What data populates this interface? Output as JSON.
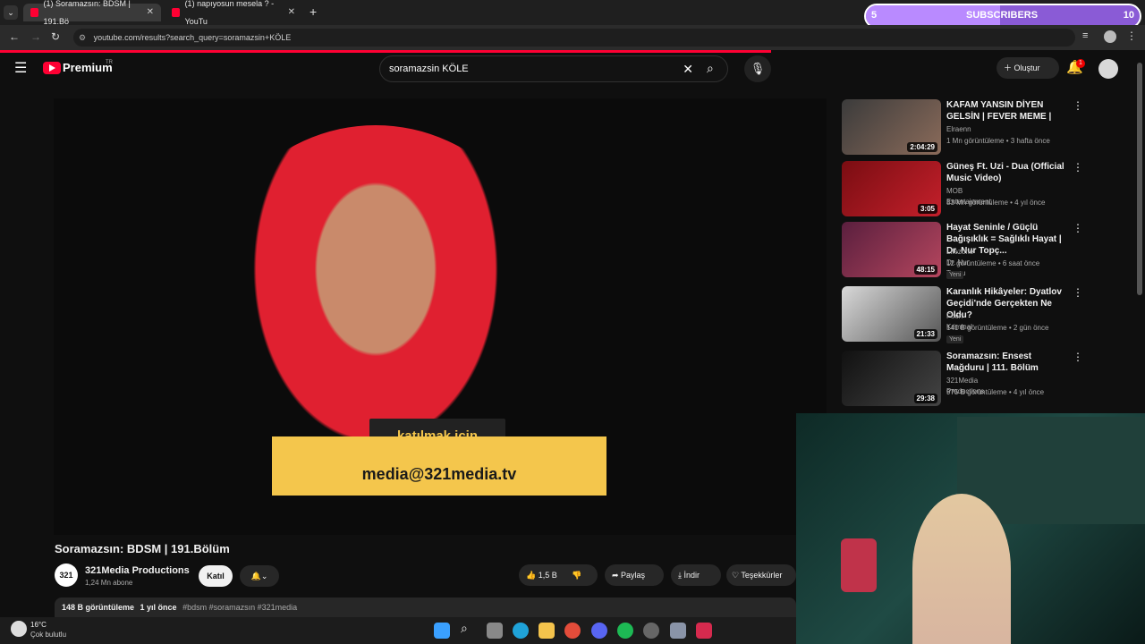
{
  "browser": {
    "tabs": [
      {
        "title": "(1) Soramazsın: BDSM | 191.Bö"
      },
      {
        "title": "(1) napıyosun mesela ? - YouTu"
      }
    ],
    "url": "youtube.com/results?search_query=soramazsin+KÖLE"
  },
  "overlay": {
    "sub_count": "5",
    "sub_label": "SUBSCRIBERS",
    "sub_goal": "10"
  },
  "youtube": {
    "logo": "Premium",
    "region": "TR",
    "search_value": "soramazsin KÖLE",
    "create_label": "Oluştur",
    "notif_count": "1",
    "video": {
      "caption_top": "katılmak için",
      "caption_bottom": "media@321media.tv",
      "title": "Soramazsın: BDSM | 191.Bölüm",
      "channel": "321Media Productions",
      "channel_avatar": "321",
      "subscribers": "1,24 Mn abone",
      "join_label": "Katıl",
      "likes": "1,5 B",
      "share_label": "Paylaş",
      "download_label": "İndir",
      "thanks_label": "Teşekkürler",
      "views": "148 B görüntüleme",
      "age": "1 yıl önce",
      "hashtags": "#bdsm #soramazsın #321media"
    },
    "recommendations": [
      {
        "title": "KAFAM YANSIN DİYEN GELSİN | FEVER MEME |",
        "channel": "Elraenn",
        "meta": "1 Mn görüntüleme • 3 hafta önce",
        "duration": "2:04:29",
        "new": ""
      },
      {
        "title": "Güneş Ft. Uzi - Dua (Official Music Video)",
        "channel": "MOB Entertainment",
        "meta": "83 Mn görüntüleme • 4 yıl önce",
        "duration": "3:05",
        "new": ""
      },
      {
        "title": "Hayat Seninle / Güçlü Bağışıklık = Sağlıklı Hayat | Dr. Nur Topç...",
        "channel": "Lifezone Dr. Nur Topcu",
        "meta": "12 görüntüleme • 6 saat önce",
        "duration": "48:15",
        "new": "Yeni"
      },
      {
        "title": "Karanlık Hikâyeler: Dyatlov Geçidi'nde Gerçekten Ne Oldu?",
        "channel": "Foon Kriminal",
        "meta": "141 B görüntüleme • 2 gün önce",
        "duration": "21:33",
        "new": "Yeni"
      },
      {
        "title": "Soramazsın: Ensest Mağduru | 111. Bölüm",
        "channel": "321Media Productions",
        "meta": "975 B görüntüleme • 4 yıl önce",
        "duration": "29:38",
        "new": ""
      }
    ]
  },
  "taskbar": {
    "temperature": "16°C",
    "weather": "Çok bulutlu"
  }
}
